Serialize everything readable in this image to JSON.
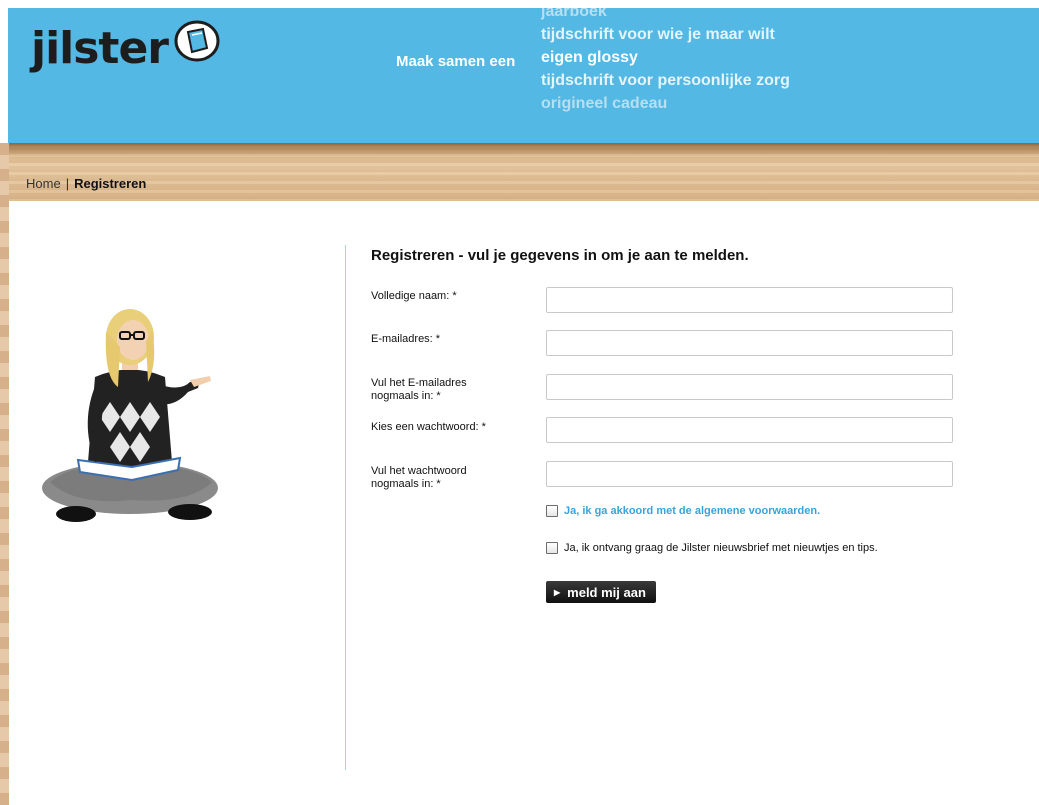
{
  "header": {
    "logo_text": "jilster",
    "tagline_lead": "Maak samen een",
    "rotator": [
      "jaarboek",
      "tijdschrift voor wie je maar wilt",
      "eigen glossy",
      "tijdschrift voor persoonlijke zorg",
      "origineel cadeau"
    ],
    "colors": {
      "header_bg": "#53b8e4",
      "link_blue": "#3aa3d9"
    }
  },
  "breadcrumb": {
    "home": "Home",
    "separator": "|",
    "current": "Registreren"
  },
  "form": {
    "title": "Registreren - vul je gegevens in om je aan te melden.",
    "fields": [
      {
        "label": "Volledige naam: *",
        "value": ""
      },
      {
        "label": "E-mailadres: *",
        "value": ""
      },
      {
        "label": "Vul het E-mailadres nogmaals in: *",
        "value": ""
      },
      {
        "label": "Kies een wachtwoord: *",
        "value": ""
      },
      {
        "label": "Vul het wachtwoord nogmaals in: *",
        "value": ""
      }
    ],
    "terms_label": "Ja, ik ga akkoord met de algemene voorwaarden.",
    "newsletter_label": "Ja, ik ontvang graag de Jilster nieuwsbrief met nieuwtjes en tips.",
    "submit_label": "meld mij aan"
  }
}
